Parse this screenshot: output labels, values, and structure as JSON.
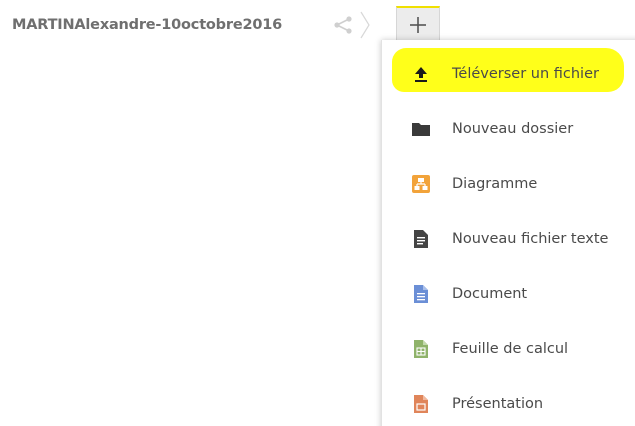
{
  "breadcrumb": {
    "folder_name": "MARTINAlexandre-10octobre2016"
  },
  "toolbar": {
    "share_icon": "share-icon",
    "new_icon": "plus-icon"
  },
  "new_menu": {
    "items": [
      {
        "label": "Téléverser un fichier",
        "icon": "upload-icon",
        "color": "#1a1a1a",
        "highlighted": true
      },
      {
        "label": "Nouveau dossier",
        "icon": "folder-icon",
        "color": "#3a3a3a"
      },
      {
        "label": "Diagramme",
        "icon": "diagram-icon",
        "color": "#f2a33a"
      },
      {
        "label": "Nouveau fichier texte",
        "icon": "text-file-icon",
        "color": "#444444"
      },
      {
        "label": "Document",
        "icon": "document-icon",
        "color": "#6b8fd6"
      },
      {
        "label": "Feuille de calcul",
        "icon": "spreadsheet-icon",
        "color": "#8fb36a"
      },
      {
        "label": "Présentation",
        "icon": "presentation-icon",
        "color": "#e0855a"
      }
    ]
  },
  "colors": {
    "highlight": "#ffff1a",
    "new_button_accent": "#f0e000"
  }
}
